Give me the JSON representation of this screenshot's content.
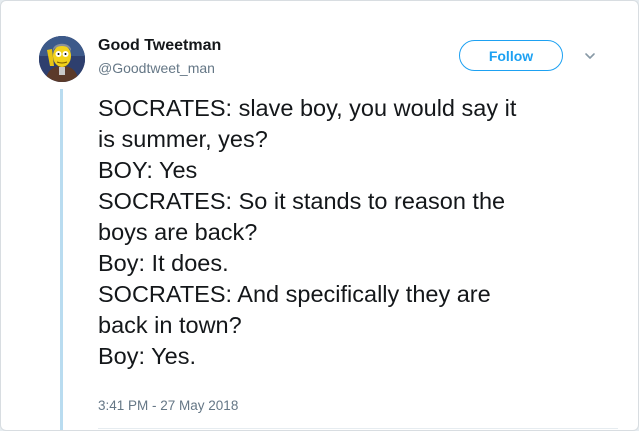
{
  "user": {
    "display_name": "Good Tweetman",
    "handle": "@Goodtweet_man",
    "avatar_icon": "cartoon-avatar-icon"
  },
  "actions": {
    "follow_label": "Follow",
    "more_icon": "chevron-down-icon"
  },
  "tweet": {
    "lines": [
      "SOCRATES: slave boy, you would say it",
      "is summer, yes?",
      "BOY: Yes",
      "SOCRATES: So it stands to reason the",
      "boys are back?",
      "Boy: It does.",
      "SOCRATES: And specifically they are",
      "back in town?",
      "Boy: Yes."
    ],
    "timestamp": "3:41 PM - 27 May 2018"
  },
  "colors": {
    "accent": "#1da1f2",
    "text": "#14171a",
    "muted": "#657786",
    "thread_line": "#b9dcf0"
  }
}
